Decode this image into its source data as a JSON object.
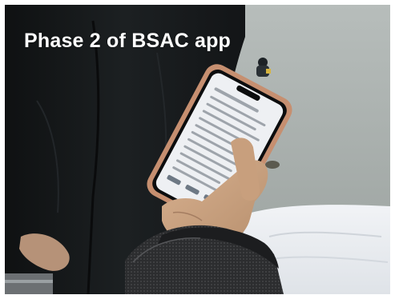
{
  "slide": {
    "caption": "Phase 2 of BSAC app"
  },
  "colors": {
    "jacket": "#16191b",
    "water": "#a3aaa7",
    "snow": "#ebedf0",
    "phone_case": "#c68f70",
    "skin": "#c9a07e",
    "sleeve": "#2f3032",
    "screen": "#eef0f3",
    "caption_text": "#ffffff"
  },
  "scene": {
    "icons": [
      "smartphone-icon",
      "hand-icon",
      "drysuit-sleeve-icon",
      "diver-icon"
    ]
  }
}
